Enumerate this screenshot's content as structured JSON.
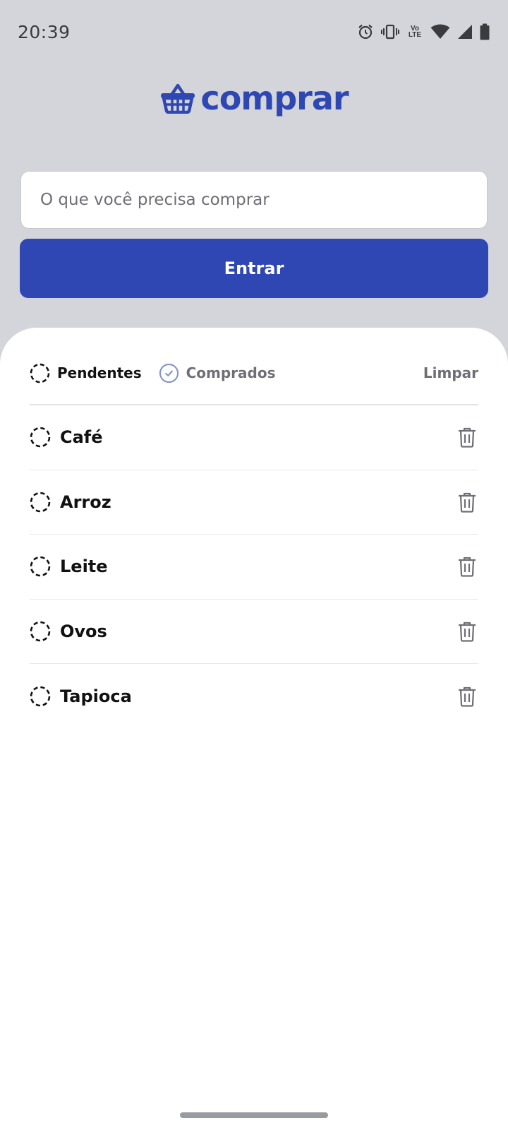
{
  "status_bar": {
    "time": "20:39",
    "volte_line1": "Vo",
    "volte_line2": "LTE",
    "icons": [
      "alarm-icon",
      "vibrate-icon",
      "volte-icon",
      "wifi-icon",
      "signal-icon",
      "battery-icon"
    ]
  },
  "app": {
    "logo_text": "comprar",
    "brand_color": "#2E47B3"
  },
  "search": {
    "placeholder": "O que você precisa comprar",
    "value": ""
  },
  "enter_button": {
    "label": "Entrar"
  },
  "filters": {
    "pending_label": "Pendentes",
    "bought_label": "Comprados",
    "clear_label": "Limpar"
  },
  "items": [
    {
      "label": "Café"
    },
    {
      "label": "Arroz"
    },
    {
      "label": "Leite"
    },
    {
      "label": "Ovos"
    },
    {
      "label": "Tapioca"
    }
  ]
}
